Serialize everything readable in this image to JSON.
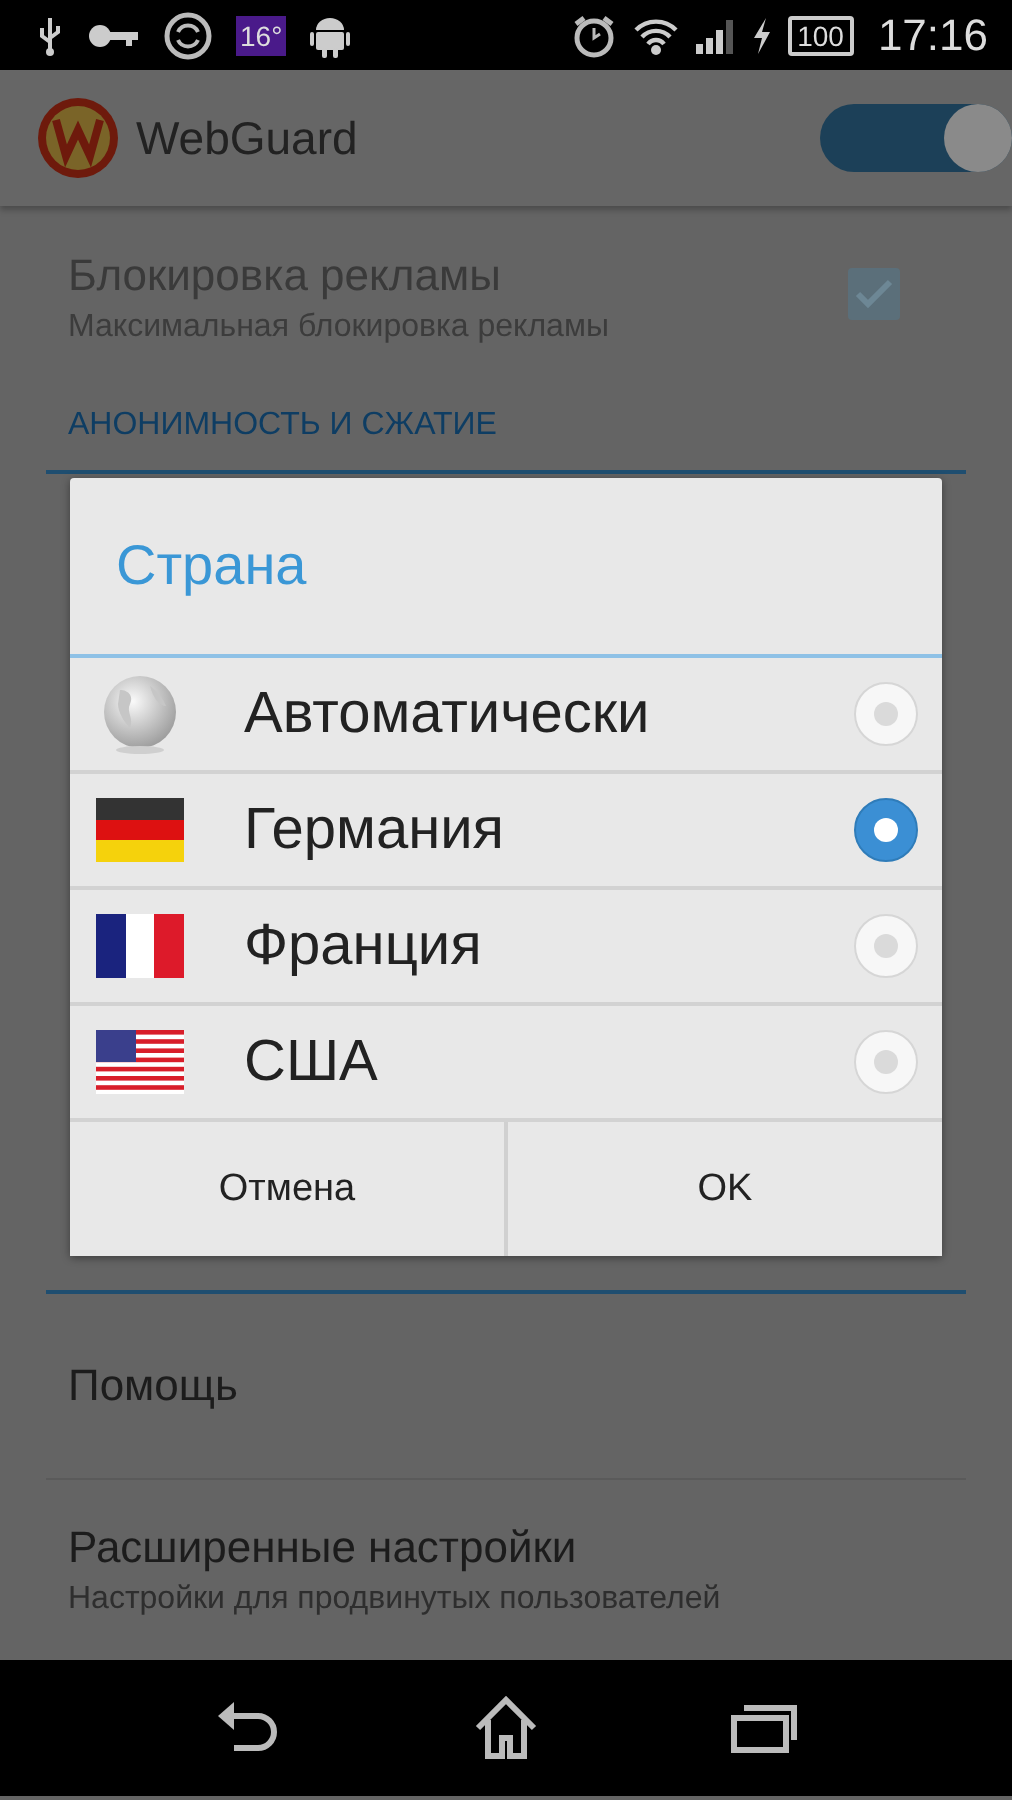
{
  "status_bar": {
    "weather": "16°",
    "battery": "100",
    "time": "17:16"
  },
  "app_bar": {
    "title": "WebGuard",
    "toggle_on": true
  },
  "settings": [
    {
      "title": "Блокировка рекламы",
      "subtitle": "Максимальная блокировка рекламы",
      "checked": true,
      "disabled": true
    }
  ],
  "section_header": "АНОНИМНОСТЬ И СЖАТИЕ",
  "other_items": [
    {
      "title": "Помощь"
    },
    {
      "title": "Расширенные настройки",
      "subtitle": "Настройки для продвинутых пользователей"
    }
  ],
  "dialog": {
    "title": "Страна",
    "options": [
      {
        "kind": "globe",
        "label": "Автоматически",
        "selected": false
      },
      {
        "kind": "de",
        "label": "Германия",
        "selected": true
      },
      {
        "kind": "fr",
        "label": "Франция",
        "selected": false
      },
      {
        "kind": "us",
        "label": "США",
        "selected": false
      }
    ],
    "buttons": [
      "Отмена",
      "OK"
    ]
  }
}
